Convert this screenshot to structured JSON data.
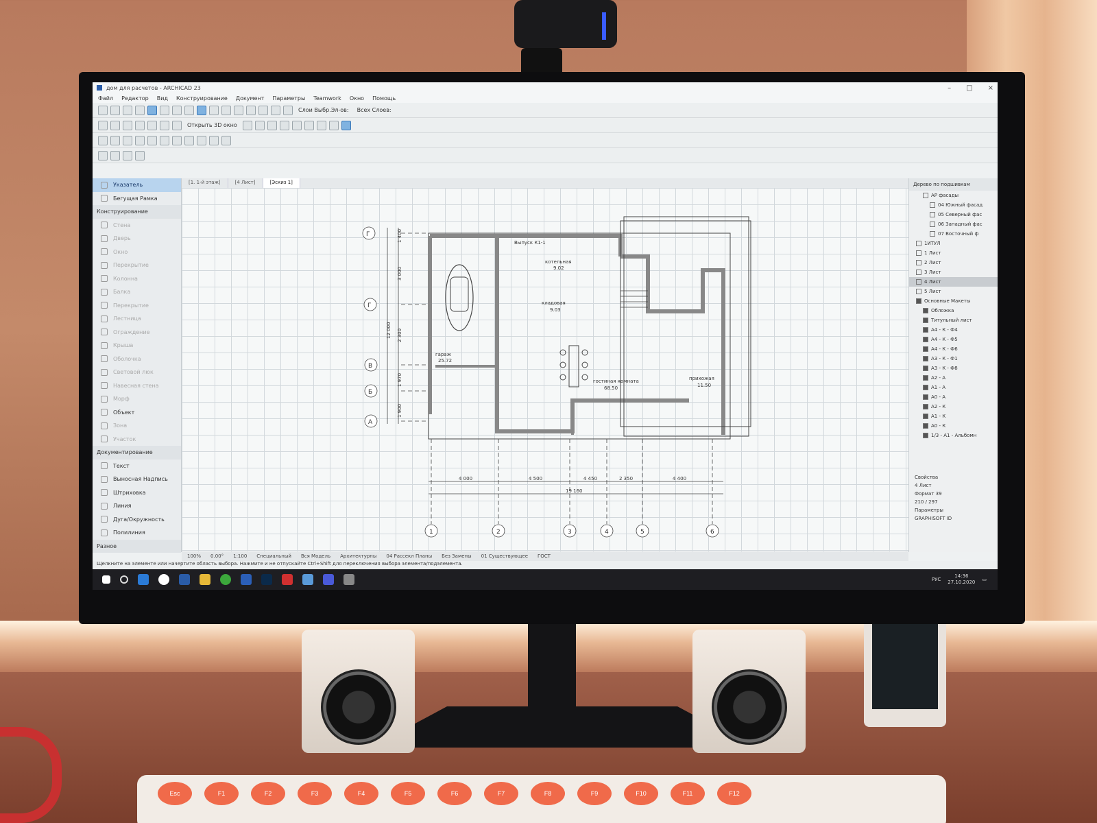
{
  "window": {
    "title": "дом для расчетов - ARCHICAD 23"
  },
  "menu": [
    "Файл",
    "Редактор",
    "Вид",
    "Конструирование",
    "Документ",
    "Параметры",
    "Teamwork",
    "Окно",
    "Помощь"
  ],
  "toolbar": {
    "open3d_label": "Открыть 3D окно",
    "layer_label": "Слои Выбр.Эл-ов:",
    "all_layers_label": "Всех Слоев:"
  },
  "toolbox": {
    "items": [
      {
        "label": "Указатель",
        "state": "selected"
      },
      {
        "label": "Бегущая Рамка",
        "state": "enabled"
      },
      {
        "label": "Конструирование",
        "state": "section"
      },
      {
        "label": "Стена",
        "state": "disabled"
      },
      {
        "label": "Дверь",
        "state": "disabled"
      },
      {
        "label": "Окно",
        "state": "disabled"
      },
      {
        "label": "Перекрытие",
        "state": "disabled"
      },
      {
        "label": "Колонна",
        "state": "disabled"
      },
      {
        "label": "Балка",
        "state": "disabled"
      },
      {
        "label": "Перекрытие",
        "state": "disabled"
      },
      {
        "label": "Лестница",
        "state": "disabled"
      },
      {
        "label": "Ограждение",
        "state": "disabled"
      },
      {
        "label": "Крыша",
        "state": "disabled"
      },
      {
        "label": "Оболочка",
        "state": "disabled"
      },
      {
        "label": "Световой люк",
        "state": "disabled"
      },
      {
        "label": "Навесная стена",
        "state": "disabled"
      },
      {
        "label": "Морф",
        "state": "disabled"
      },
      {
        "label": "Объект",
        "state": "enabled"
      },
      {
        "label": "Зона",
        "state": "disabled"
      },
      {
        "label": "Участок",
        "state": "disabled"
      },
      {
        "label": "Документирование",
        "state": "section"
      },
      {
        "label": "Текст",
        "state": "enabled"
      },
      {
        "label": "Выносная Надпись",
        "state": "enabled"
      },
      {
        "label": "Штриховка",
        "state": "enabled"
      },
      {
        "label": "Линия",
        "state": "enabled"
      },
      {
        "label": "Дуга/Окружность",
        "state": "enabled"
      },
      {
        "label": "Полилиния",
        "state": "enabled"
      },
      {
        "label": "Разное",
        "state": "section"
      }
    ]
  },
  "tabs": [
    {
      "label": "[1. 1-й этаж]",
      "active": false
    },
    {
      "label": "[4 Лист]",
      "active": false
    },
    {
      "label": "[Эскиз 1]",
      "active": true
    }
  ],
  "plan": {
    "rooms": [
      {
        "name": "гараж",
        "area": "25.72"
      },
      {
        "name": "котельная",
        "area": "9.02"
      },
      {
        "name": "кладовая",
        "area": "9.03"
      },
      {
        "name": "гостиная комната",
        "area": "68.50"
      },
      {
        "name": "прихожая",
        "area": "11.50"
      }
    ],
    "label_top": "Выпуск К1-1",
    "axes_letters": [
      "Г",
      "Г",
      "В",
      "Б",
      "А"
    ],
    "axes_numbers": [
      "1",
      "2",
      "3",
      "4",
      "5",
      "6"
    ],
    "dims_bottom": [
      "4 000",
      "4 500",
      "4 450",
      "2 350",
      "4 400"
    ],
    "dim_total": "19 160",
    "dims_left": [
      "1 400",
      "3 000",
      "2 300",
      "1 970",
      "1 900"
    ],
    "dim_left_total": "12 000"
  },
  "navigator": {
    "header": "Дерево по подшивкам",
    "items": [
      {
        "label": "АР фасады",
        "level": 2,
        "sel": false,
        "dark": false
      },
      {
        "label": "04 Южный фасад",
        "level": 3,
        "sel": false,
        "dark": false
      },
      {
        "label": "05 Северный фас",
        "level": 3,
        "sel": false,
        "dark": false
      },
      {
        "label": "06 Западный фас",
        "level": 3,
        "sel": false,
        "dark": false
      },
      {
        "label": "07 Восточный ф",
        "level": 3,
        "sel": false,
        "dark": false
      },
      {
        "label": "1ИТУЛ",
        "level": 1,
        "sel": false,
        "dark": false
      },
      {
        "label": "1 Лист",
        "level": 1,
        "sel": false,
        "dark": false
      },
      {
        "label": "2 Лист",
        "level": 1,
        "sel": false,
        "dark": false
      },
      {
        "label": "3 Лист",
        "level": 1,
        "sel": false,
        "dark": false
      },
      {
        "label": "4 Лист",
        "level": 1,
        "sel": true,
        "dark": false
      },
      {
        "label": "5 Лист",
        "level": 1,
        "sel": false,
        "dark": false
      },
      {
        "label": "Основные Макеты",
        "level": 1,
        "sel": false,
        "dark": true
      },
      {
        "label": "Обложка",
        "level": 2,
        "sel": false,
        "dark": true
      },
      {
        "label": "Титульный лист",
        "level": 2,
        "sel": false,
        "dark": true
      },
      {
        "label": "А4 - К - Ф4",
        "level": 2,
        "sel": false,
        "dark": true
      },
      {
        "label": "А4 - К - Ф5",
        "level": 2,
        "sel": false,
        "dark": true
      },
      {
        "label": "А4 - К - Ф6",
        "level": 2,
        "sel": false,
        "dark": true
      },
      {
        "label": "А3 - К - Ф1",
        "level": 2,
        "sel": false,
        "dark": true
      },
      {
        "label": "А3 - К - Ф8",
        "level": 2,
        "sel": false,
        "dark": true
      },
      {
        "label": "А2 - А",
        "level": 2,
        "sel": false,
        "dark": true
      },
      {
        "label": "А1 - А",
        "level": 2,
        "sel": false,
        "dark": true
      },
      {
        "label": "А0 - А",
        "level": 2,
        "sel": false,
        "dark": true
      },
      {
        "label": "А2 - К",
        "level": 2,
        "sel": false,
        "dark": true
      },
      {
        "label": "А1 - К",
        "level": 2,
        "sel": false,
        "dark": true
      },
      {
        "label": "А0 - К",
        "level": 2,
        "sel": false,
        "dark": true
      },
      {
        "label": "1/3 - А1 - Альбомн",
        "level": 2,
        "sel": false,
        "dark": true
      }
    ],
    "props_header": "Свойства",
    "props_name": "4 Лист",
    "props_format": "Формат 39",
    "props_size": "210 / 297",
    "params_label": "Параметры",
    "vendor": "GRAPHISOFT ID"
  },
  "status": {
    "zoom": "100%",
    "angle": "0.00°",
    "scale": "1:100",
    "layer_combo": "Специальный",
    "model_view": "Вся Модель",
    "pen_set": "Архитектурны",
    "model_set": "04 Рассекл Планы",
    "renovation": "Без Замены",
    "renov2": "01 Существующее",
    "standard": "ГОСТ"
  },
  "hint": "Щелкните на элементе или начертите область выбора. Нажмите и не отпускайте Ctrl+Shift для переключения выбора элемента/подэлемента.",
  "taskbar": {
    "lang": "РУС",
    "time": "14:36",
    "date": "27.10.2020"
  },
  "keyboard": {
    "keys": [
      "Esc",
      "F1",
      "F2",
      "F3",
      "F4",
      "F5",
      "F6",
      "F7",
      "F8",
      "F9",
      "F10",
      "F11",
      "F12"
    ]
  }
}
